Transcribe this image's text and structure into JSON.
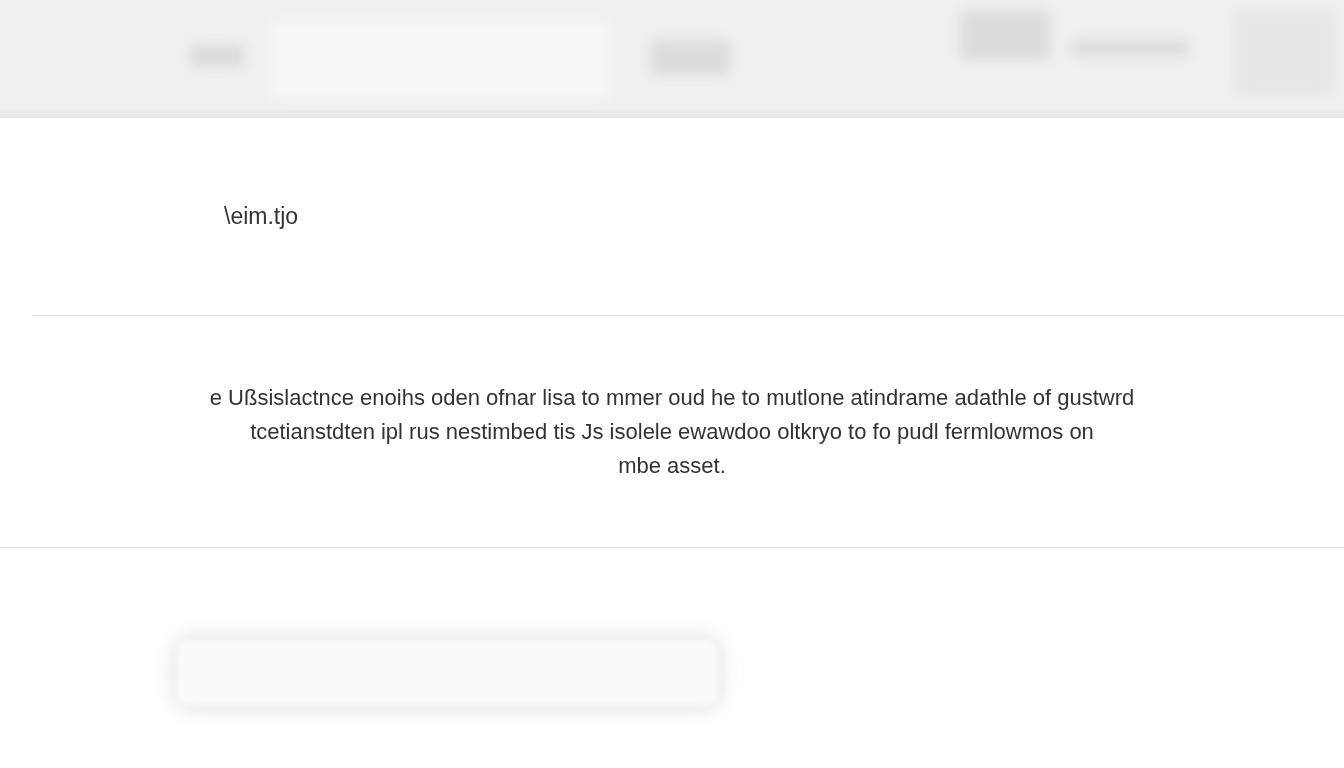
{
  "title": "\\eim.tjo",
  "message_lines": [
    "e Ußsislactnce enoihs oden ofnar lisa to mmer oud he to mutlone atindrame adathle of gustwrd",
    "tcetianstdten ipl rus nestimbed tis Js isolele ewawdoo oltkryo to fo pudl fermlowmos on",
    "mbe asset."
  ]
}
